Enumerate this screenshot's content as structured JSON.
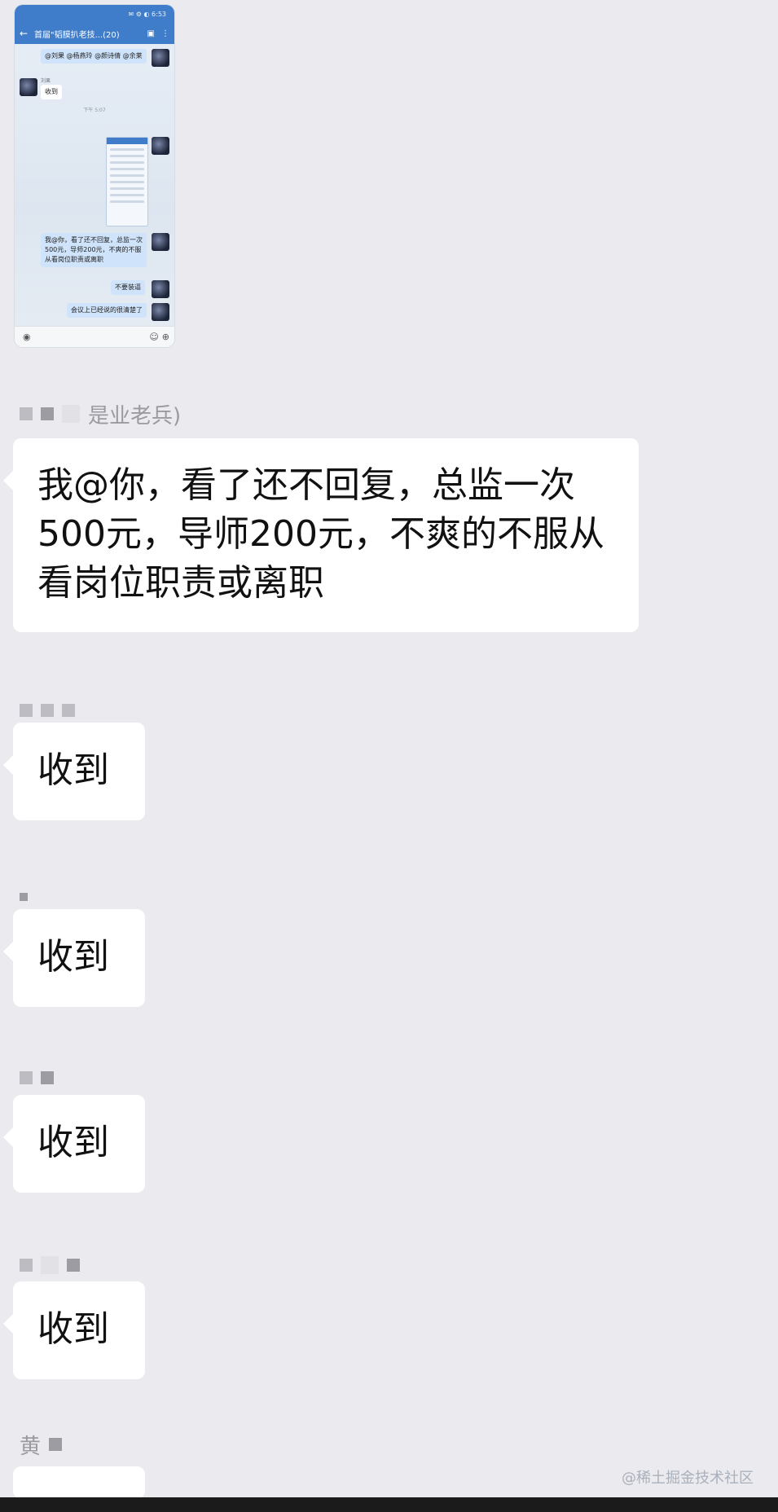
{
  "embedded_screenshot": {
    "status_text": "✉ ⚙ ◐ 6:53",
    "header": {
      "back_icon": "arrow-left-icon",
      "title": "首届\"韬膜扒老技...(20)",
      "video_icon": "video-call-icon",
      "more_icon": "more-vertical-icon"
    },
    "messages": [
      {
        "text": "@刘果 @杨燕玲 @颜诗倩 @余莱"
      },
      {
        "sender": "刘果",
        "text": "收到"
      },
      {
        "time": "下午 5:07"
      },
      {
        "text": "我@你，看了还不回复，总监一次500元，导师200元，不爽的不服从看岗位职责或离职"
      },
      {
        "text": "不要装逼"
      },
      {
        "text": "会议上已经说的很清楚了"
      }
    ],
    "input_icons": [
      "voice-icon",
      "emoji-icon",
      "plus-icon"
    ]
  },
  "chat": {
    "sender_1_name": "是业老兵)",
    "message_1": "我@你，看了还不回复，总监一次500元，导师200元，不爽的不服从看岗位职责或离职",
    "reply_1": "收到",
    "reply_2": "收到",
    "reply_3": "收到",
    "reply_4": "收到",
    "sender_6_name": "黄"
  },
  "watermark": "@稀土掘金技术社区",
  "colors": {
    "background": "#ebebef",
    "bubble": "#ffffff",
    "app_header": "#3f7cc9"
  }
}
